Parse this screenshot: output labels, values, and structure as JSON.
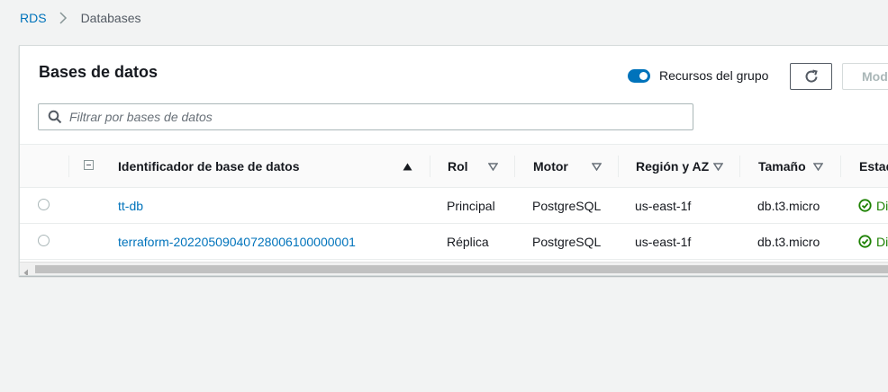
{
  "breadcrumb": {
    "root": "RDS",
    "current": "Databases"
  },
  "panel": {
    "title": "Bases de datos",
    "group_toggle": {
      "label": "Recursos del grupo",
      "on": true
    },
    "modify_label": "Mod",
    "search_placeholder": "Filtrar por bases de datos"
  },
  "table": {
    "columns": [
      "Identificador de base de datos",
      "Rol",
      "Motor",
      "Región y AZ",
      "Tamaño",
      "Estad"
    ],
    "rows": [
      {
        "id": "tt-db",
        "role": "Principal",
        "engine": "PostgreSQL",
        "region": "us-east-1f",
        "size": "db.t3.micro",
        "status": "Di"
      },
      {
        "id": "terraform-20220509040728006100000001",
        "role": "Réplica",
        "engine": "PostgreSQL",
        "region": "us-east-1f",
        "size": "db.t3.micro",
        "status": "Di"
      }
    ]
  },
  "colors": {
    "link": "#0073bb",
    "success": "#1d8102",
    "toggle_on": "#0073bb"
  },
  "icons": [
    "chevron-right-icon",
    "refresh-icon",
    "search-icon",
    "sort-ascending-icon",
    "sort-descending-icon",
    "status-ok-icon",
    "scroll-left-icon"
  ]
}
